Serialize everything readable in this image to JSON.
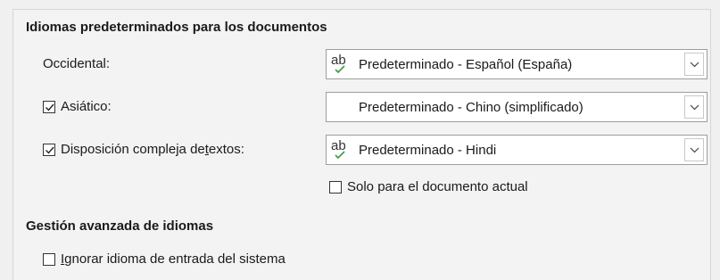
{
  "section_default_languages": {
    "title": "Idiomas predeterminados para los documentos",
    "western": {
      "label": "Occidental:",
      "value": "Predeterminado - Español (España)",
      "icon": "spellcheck-ab-icon"
    },
    "asian": {
      "label_prefix": "Asiático:",
      "checked": true,
      "value": "Predeterminado - Chino (simplificado)"
    },
    "ctl": {
      "label_pre": "Disposición compleja de ",
      "label_access": "t",
      "label_post": "extos:",
      "checked": true,
      "value": "Predeterminado - Hindi",
      "icon": "spellcheck-ab-icon"
    },
    "current_doc_only": {
      "label": "Solo para el documento actual",
      "checked": false
    }
  },
  "section_advanced": {
    "title": "Gestión avanzada de idiomas",
    "ignore_input": {
      "label_access": "I",
      "label_rest": "gnorar idioma de entrada del sistema",
      "checked": false
    }
  },
  "colors": {
    "check_green": "#3a9a3a",
    "border": "#9e9e9e"
  }
}
